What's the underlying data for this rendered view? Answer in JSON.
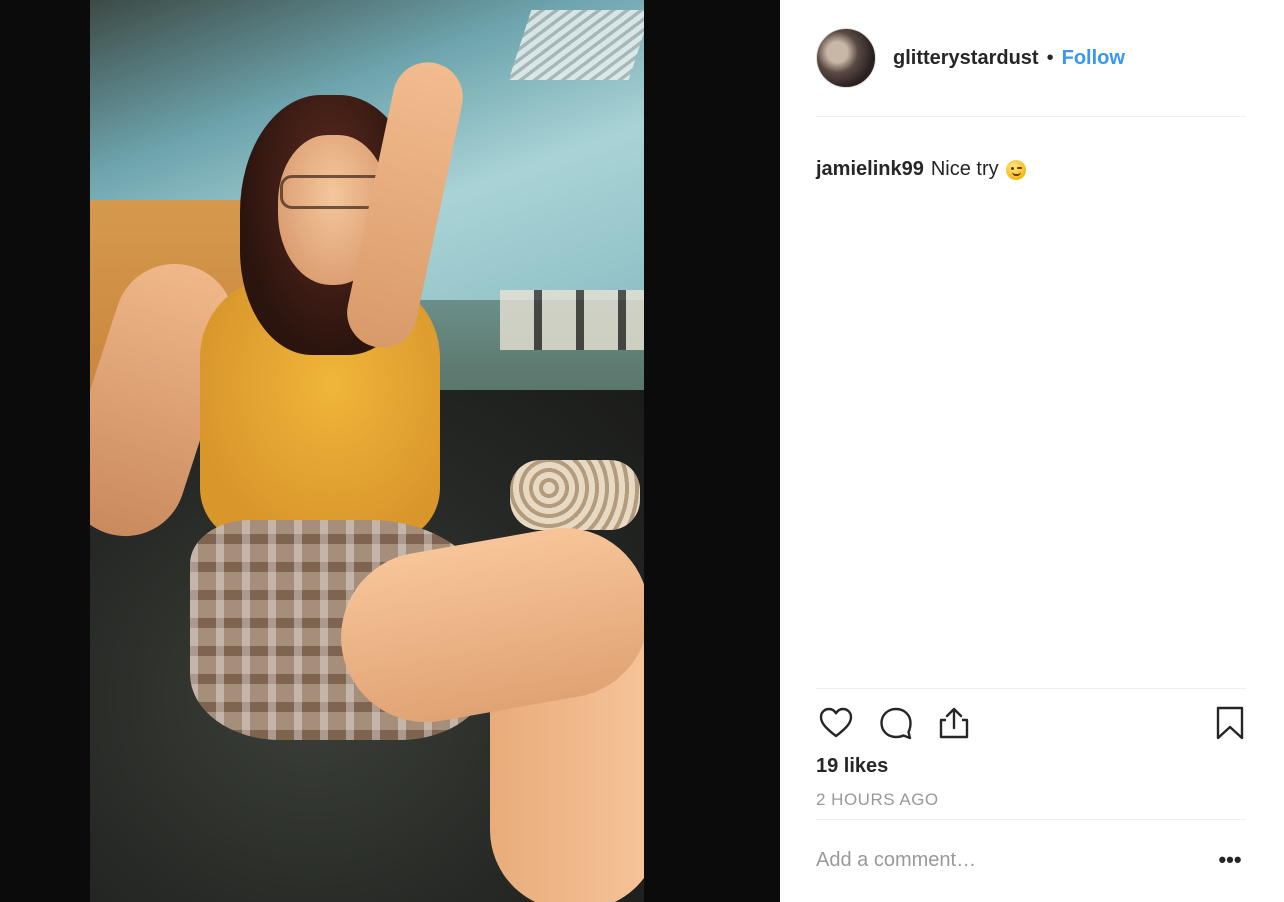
{
  "post": {
    "author": "glitterystardust",
    "separator": "•",
    "follow_label": "Follow",
    "likes": "19 likes",
    "time": "2 HOURS AGO"
  },
  "comments": [
    {
      "user": "jamielink99",
      "text": "Nice try",
      "emoji": "winking-face"
    }
  ],
  "composer": {
    "placeholder": "Add a comment…",
    "more_label": "•••"
  },
  "icons": {
    "like": "heart-icon",
    "comment": "comment-bubble-icon",
    "share": "share-icon",
    "save": "bookmark-icon"
  },
  "colors": {
    "follow": "#3897f0",
    "text": "#262626",
    "muted": "#999999"
  }
}
